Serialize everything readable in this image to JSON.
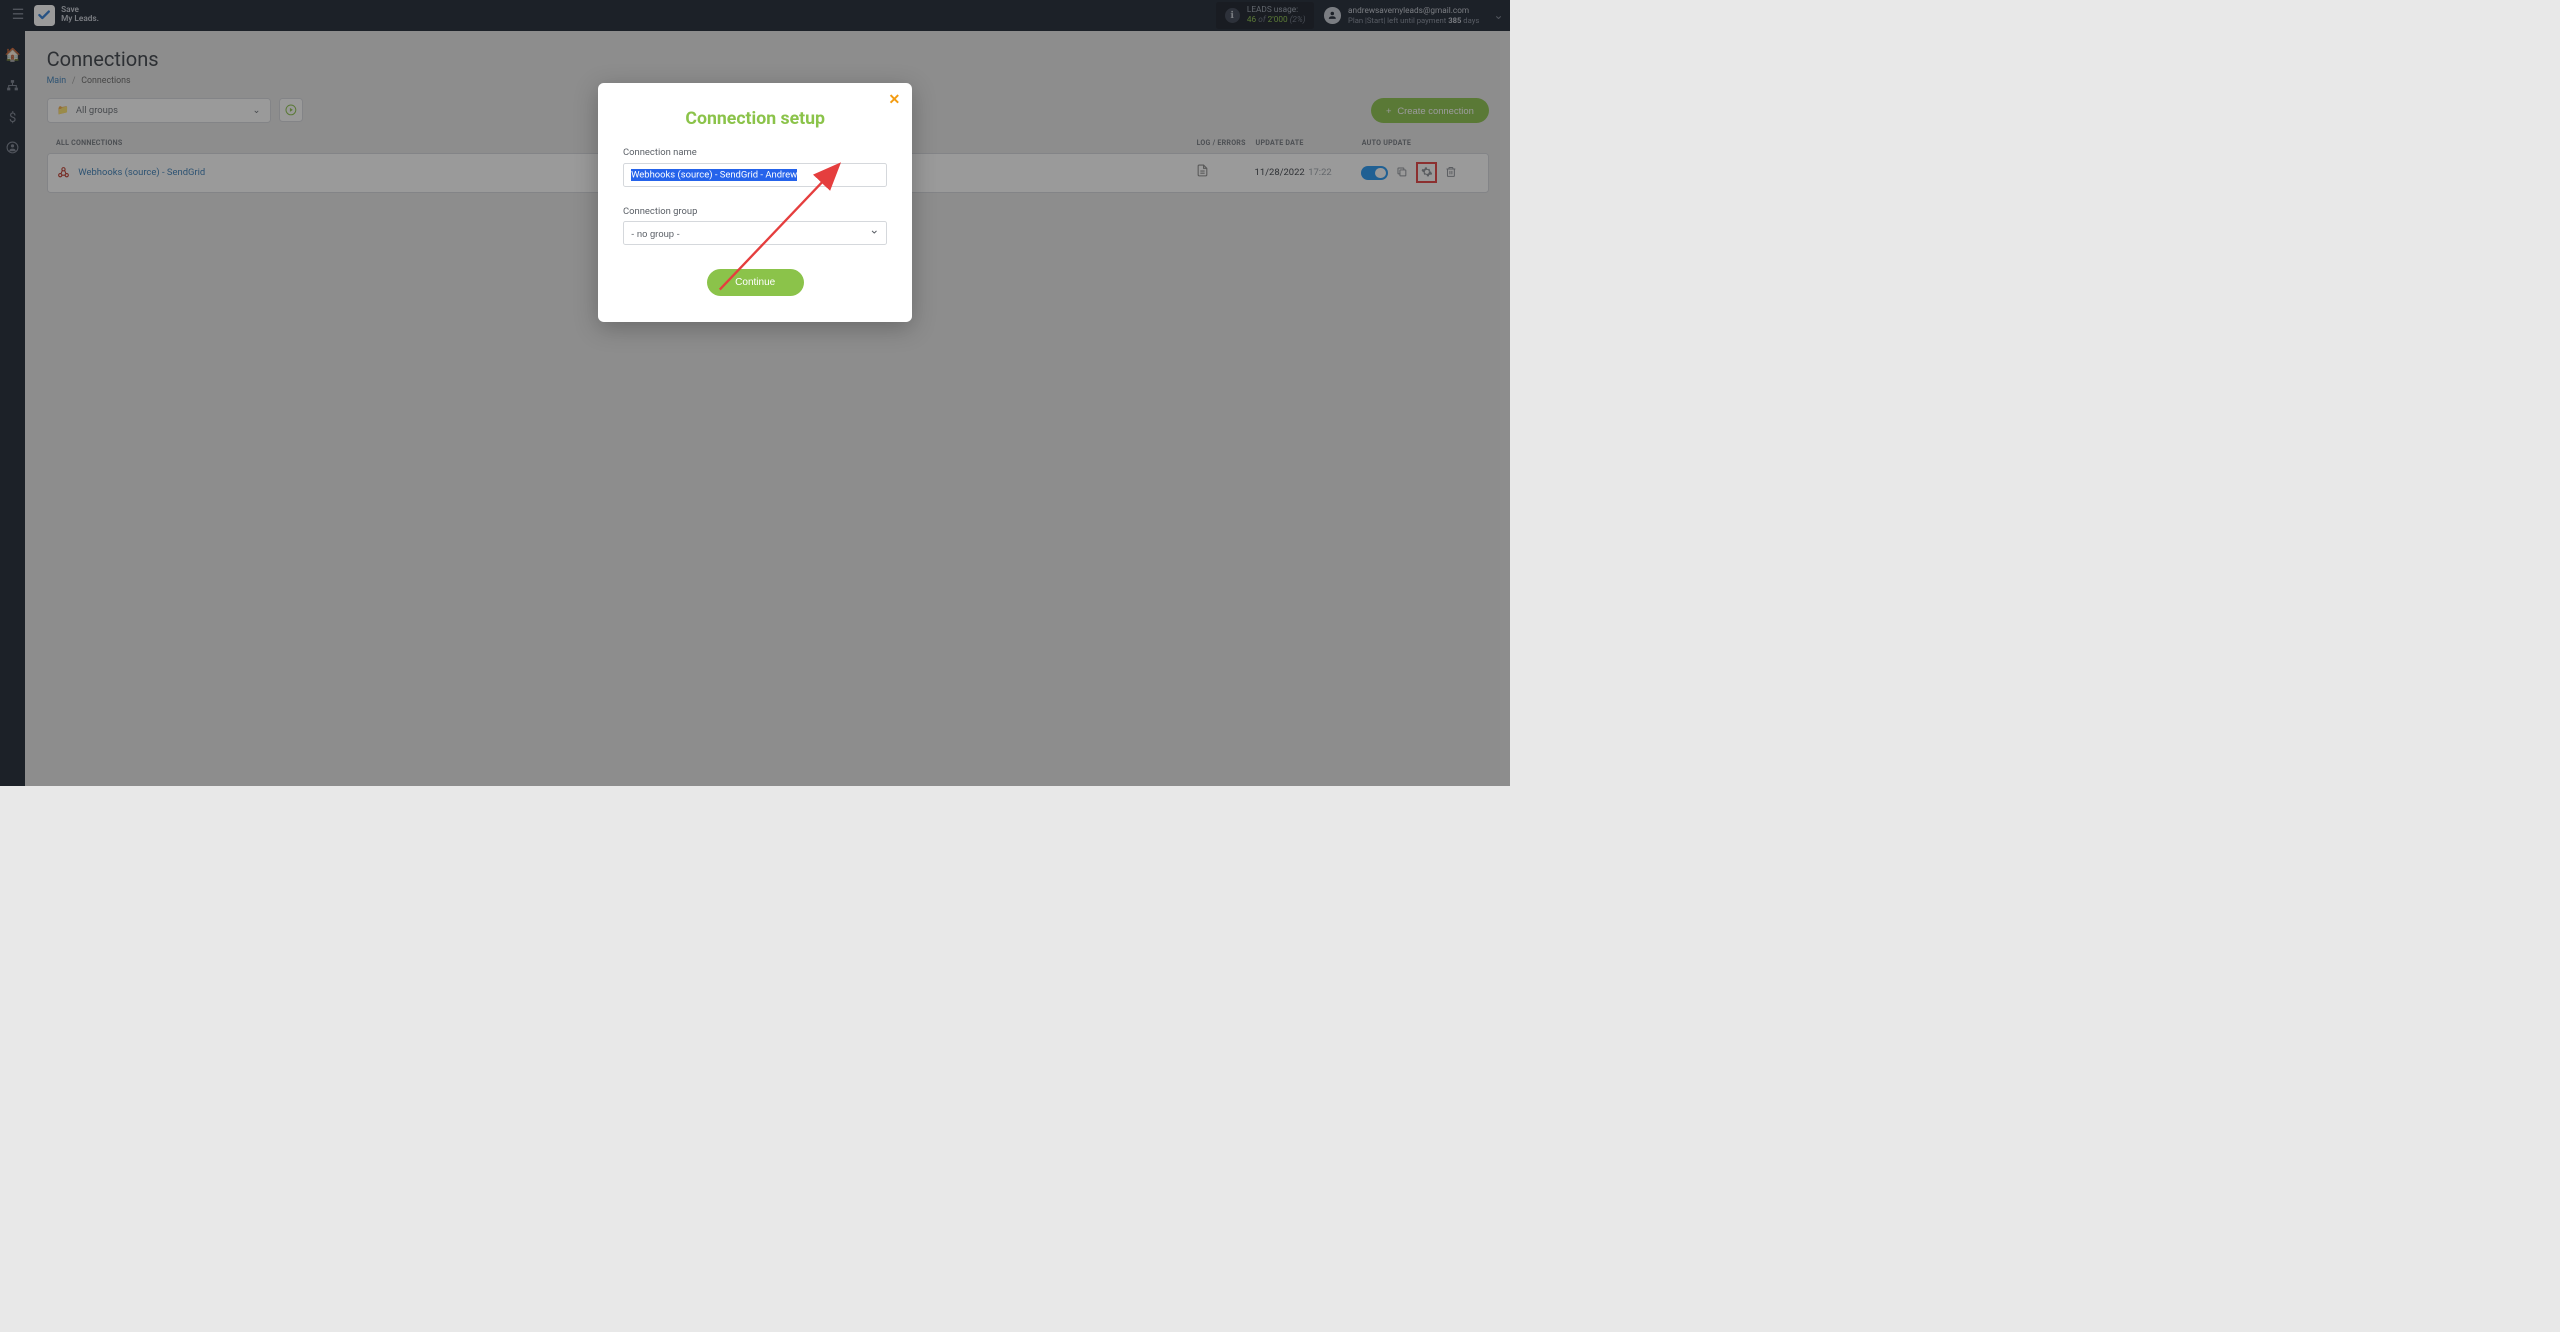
{
  "brand": {
    "line1": "Save",
    "line2": "My Leads."
  },
  "usage": {
    "label": "LEADS usage:",
    "used": "46",
    "of_word": "of",
    "total": "2'000",
    "percent": "(2%)"
  },
  "user": {
    "email": "andrewsavemyleads@gmail.com",
    "plan_prefix": "Plan |",
    "plan_name": "Start",
    "plan_mid": "| left until payment ",
    "days_count": "385",
    "days_word": " days"
  },
  "page": {
    "title": "Connections"
  },
  "breadcrumb": {
    "main": "Main",
    "current": "Connections"
  },
  "toolbar": {
    "group_label": "All groups",
    "create_btn": "Create connection"
  },
  "table": {
    "headers": {
      "all": "ALL CONNECTIONS",
      "log": "LOG / ERRORS",
      "update": "UPDATE DATE",
      "auto": "AUTO UPDATE"
    },
    "rows": [
      {
        "name": "Webhooks (source) - SendGrid",
        "date": "11/28/2022",
        "time": "17:22"
      }
    ]
  },
  "modal": {
    "title": "Connection setup",
    "name_label": "Connection name",
    "name_value": "Webhooks (source) - SendGrid - Andrew",
    "group_label": "Connection group",
    "group_value": "- no group -",
    "continue": "Continue"
  }
}
